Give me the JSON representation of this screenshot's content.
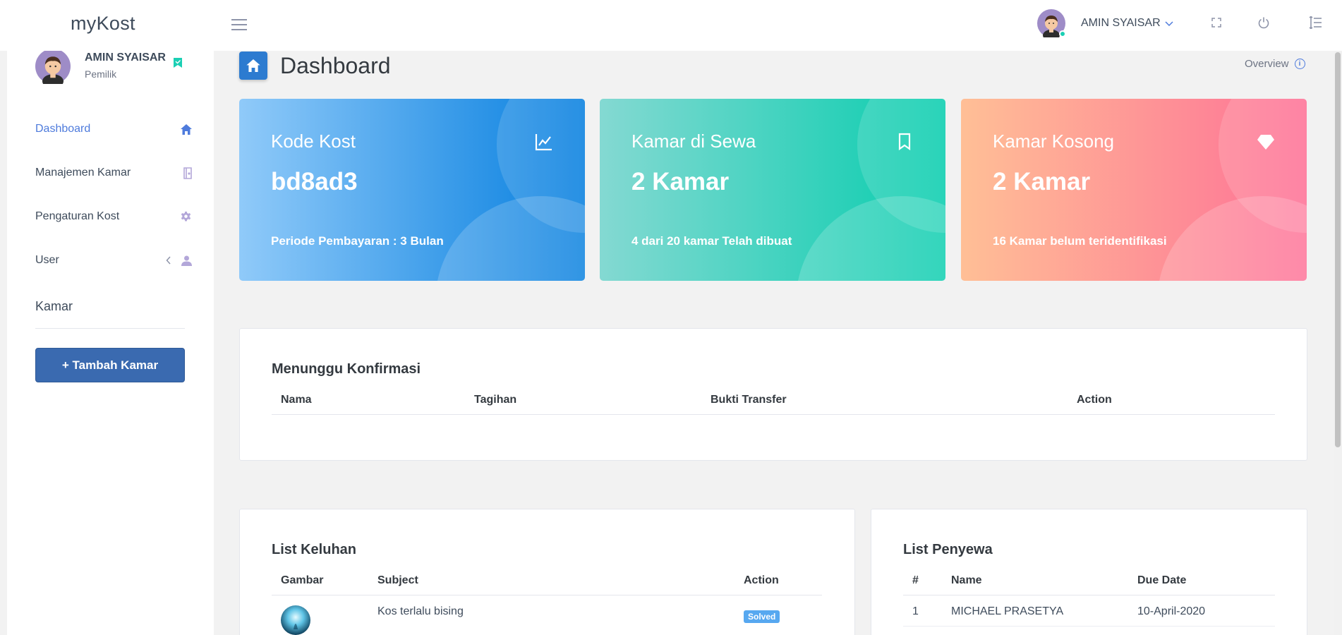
{
  "app": {
    "brand": "myKost"
  },
  "navbar": {
    "user_name": "AMIN SYAISAR"
  },
  "sidebar": {
    "profile": {
      "name": "AMIN SYAISAR",
      "role": "Pemilik"
    },
    "items": [
      {
        "label": "Dashboard",
        "icon": "home-icon",
        "active": true
      },
      {
        "label": "Manajemen Kamar",
        "icon": "door-icon",
        "active": false
      },
      {
        "label": "Pengaturan Kost",
        "icon": "gear-icon",
        "active": false
      },
      {
        "label": "User",
        "icon": "user-icon",
        "active": false
      }
    ],
    "section_title": "Kamar",
    "add_button": "+ Tambah Kamar"
  },
  "page": {
    "title": "Dashboard",
    "overview_label": "Overview",
    "overview_icon": "i"
  },
  "stats": [
    {
      "label": "Kode Kost",
      "value": "bd8ad3",
      "sub": "Periode Pembayaran : 3 Bulan",
      "icon": "chart-line-icon",
      "gradient": [
        "#90caf9",
        "#047edf"
      ]
    },
    {
      "label": "Kamar di Sewa",
      "value": "2 Kamar",
      "sub": "4 dari 20 kamar Telah dibuat",
      "icon": "bookmark-icon",
      "gradient": [
        "#84d9d2",
        "#07cdae"
      ]
    },
    {
      "label": "Kamar Kosong",
      "value": "2 Kamar",
      "sub": "16 Kamar belum teridentifikasi",
      "icon": "diamond-icon",
      "gradient": [
        "#ffbf96",
        "#fe7096"
      ]
    }
  ],
  "konfirmasi": {
    "title": "Menunggu Konfirmasi",
    "columns": [
      "Nama",
      "Tagihan",
      "Bukti Transfer",
      "Action"
    ]
  },
  "keluhan": {
    "title": "List Keluhan",
    "columns": [
      "Gambar",
      "Subject",
      "Action"
    ],
    "rows": [
      {
        "subject": "Kos terlalu bising",
        "status": "Solved"
      }
    ]
  },
  "penyewa": {
    "title": "List Penyewa",
    "columns": [
      "#",
      "Name",
      "Due Date"
    ],
    "rows": [
      {
        "no": "1",
        "name": "MICHAEL PRASETYA",
        "due": "10-April-2020"
      }
    ]
  }
}
